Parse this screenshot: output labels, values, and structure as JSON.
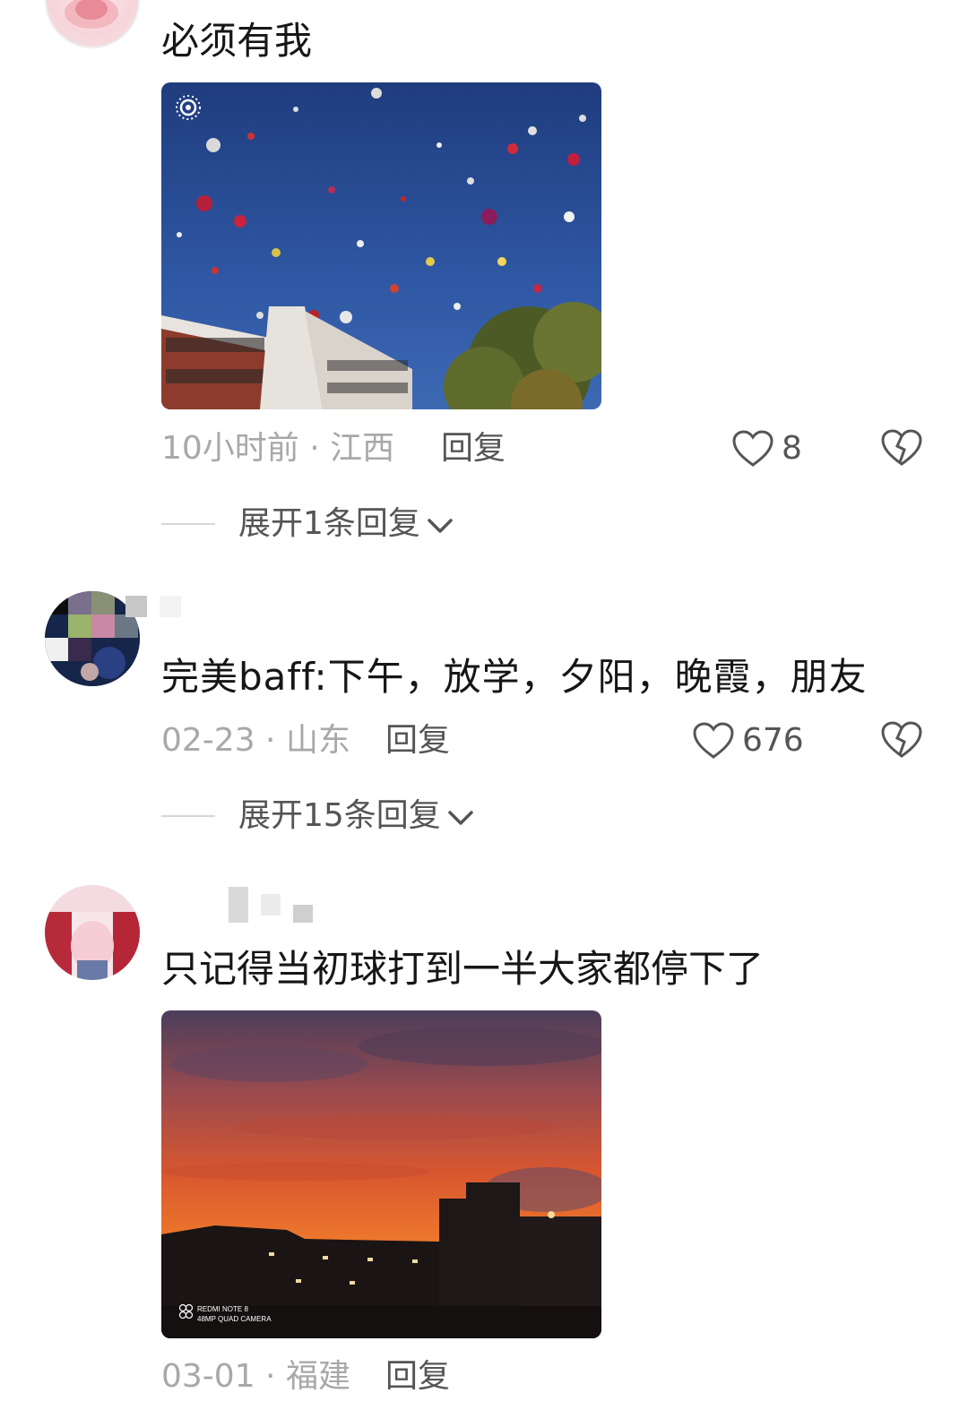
{
  "comments": [
    {
      "text": "必须有我",
      "meta": "10小时前 · 江西",
      "reply_label": "回复",
      "likes": "8",
      "expand_label": "展开1条回复"
    },
    {
      "text": "完美baff:下午，放学，夕阳，晚霞，朋友",
      "meta": "02-23 · 山东",
      "reply_label": "回复",
      "likes": "676",
      "expand_label": "展开15条回复"
    },
    {
      "text": "只记得当初球打到一半大家都停下了",
      "meta": "03-01 · 福建",
      "reply_label": "回复",
      "camera_watermark_line1": "REDMI NOTE 8",
      "camera_watermark_line2": "48MP QUAD CAMERA"
    }
  ],
  "icons": {
    "like": "heart-outline-icon",
    "dislike": "broken-heart-icon",
    "expand": "chevron-down-icon",
    "live_photo": "live-photo-icon"
  },
  "colors": {
    "meta_gray": "#a8a8a8",
    "action_gray": "#555555",
    "text": "#161616"
  }
}
